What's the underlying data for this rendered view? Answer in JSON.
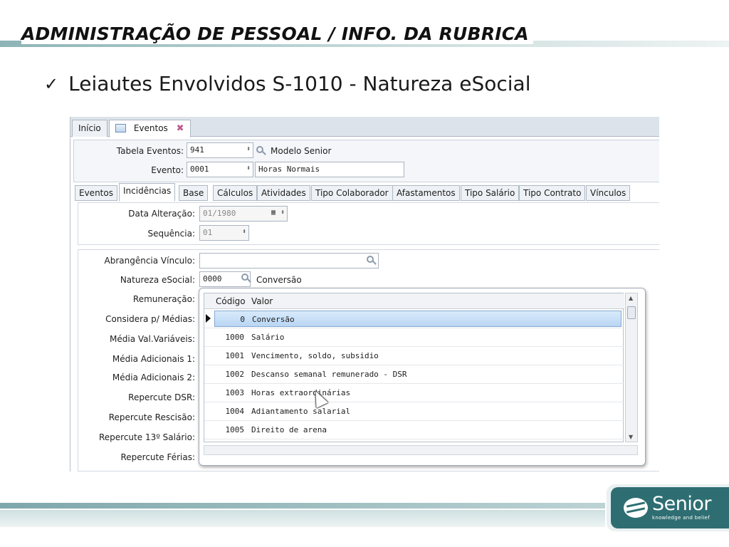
{
  "slide": {
    "title": "ADMINISTRAÇÃO DE PESSOAL / INFO. DA RUBRICA",
    "bullet_check": "✓",
    "bullet_text": "Leiautes Envolvidos S-1010 - Natureza eSocial"
  },
  "app": {
    "tabs": [
      {
        "label": "Início"
      },
      {
        "label": "Eventos",
        "active": true
      }
    ],
    "header": {
      "tabela_label": "Tabela Eventos:",
      "tabela_value": "941",
      "tabela_desc": "Modelo Senior",
      "evento_label": "Evento:",
      "evento_value": "0001",
      "evento_desc": "Horas Normais"
    },
    "inner_tabs": [
      "Eventos",
      "Incidências",
      "Base",
      "Cálculos",
      "Atividades",
      "Tipo Colaborador",
      "Afastamentos",
      "Tipo Salário",
      "Tipo Contrato",
      "Vínculos"
    ],
    "active_inner_tab": "Incidências",
    "data_alteracao_label": "Data Alteração:",
    "data_alteracao_value": "01/1980",
    "sequencia_label": "Sequência:",
    "sequencia_value": "01",
    "form_labels": [
      "Abrangência Vínculo:",
      "Natureza eSocial:",
      "Remuneração:",
      "Considera p/ Médias:",
      "Média Val.Variáveis:",
      "Média Adicionais 1:",
      "Média Adicionais 2:",
      "Repercute DSR:",
      "Repercute Rescisão:",
      "Repercute 13º Salário:",
      "Repercute Férias:"
    ],
    "natureza_value": "0000",
    "natureza_desc": "Conversão",
    "dropdown": {
      "col_code": "Código",
      "col_value": "Valor",
      "rows": [
        {
          "code": "0",
          "value": "Conversão",
          "selected": true
        },
        {
          "code": "1000",
          "value": "Salário"
        },
        {
          "code": "1001",
          "value": "Vencimento, soldo, subsidio"
        },
        {
          "code": "1002",
          "value": "Descanso semanal remunerado - DSR"
        },
        {
          "code": "1003",
          "value": "Horas extraordinárias"
        },
        {
          "code": "1004",
          "value": "Adiantamento salarial"
        },
        {
          "code": "1005",
          "value": "Direito de arena"
        }
      ]
    }
  },
  "logo": {
    "name": "Senior",
    "tagline": "knowledge and belief",
    "color": "#2e6e72"
  }
}
